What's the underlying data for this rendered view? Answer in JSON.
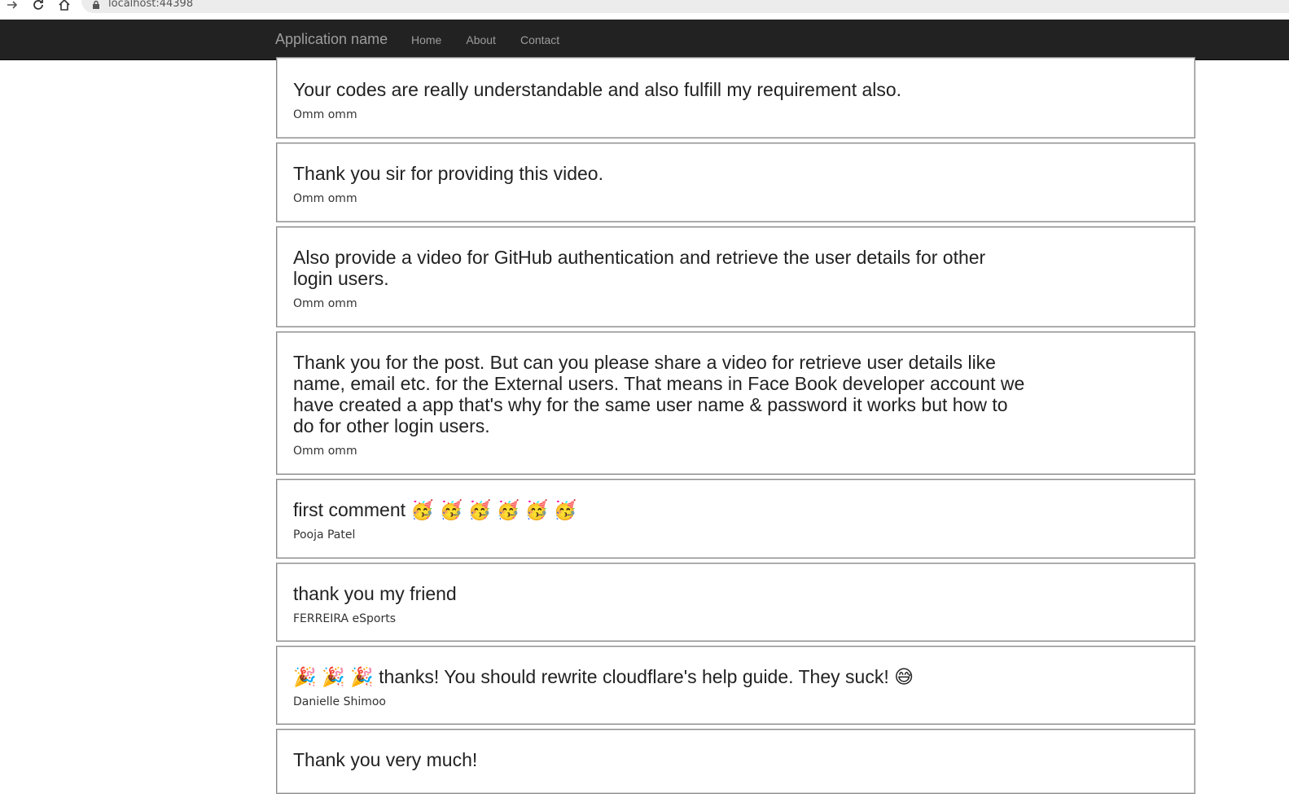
{
  "browser": {
    "url": "localhost:44398"
  },
  "navbar": {
    "brand": "Application name",
    "links": [
      {
        "label": "Home"
      },
      {
        "label": "About"
      },
      {
        "label": "Contact"
      }
    ]
  },
  "comments": [
    {
      "text": "Your codes are really understandable and also fulfill my requirement also.",
      "author": "Omm omm"
    },
    {
      "text": "Thank you sir for providing this video.",
      "author": "Omm omm"
    },
    {
      "text": "Also provide a video for GitHub authentication and retrieve the user details for other login users.",
      "author": "Omm omm"
    },
    {
      "text": "Thank you for the post. But can you please share a video for retrieve user details like name, email etc. for the External users. That means in Face Book developer account we have created a app that's why for the same user name & password it works but how to do for other login users.",
      "author": "Omm omm"
    },
    {
      "text": "first comment 🥳 🥳 🥳 🥳 🥳 🥳",
      "author": "Pooja Patel"
    },
    {
      "text": "thank you my friend",
      "author": "FERREIRA eSports"
    },
    {
      "text": "🎉 🎉 🎉 thanks! You should rewrite cloudflare's help guide. They suck! 😅",
      "author": "Danielle Shimoo"
    },
    {
      "text": "Thank you very much!",
      "author": ""
    }
  ]
}
